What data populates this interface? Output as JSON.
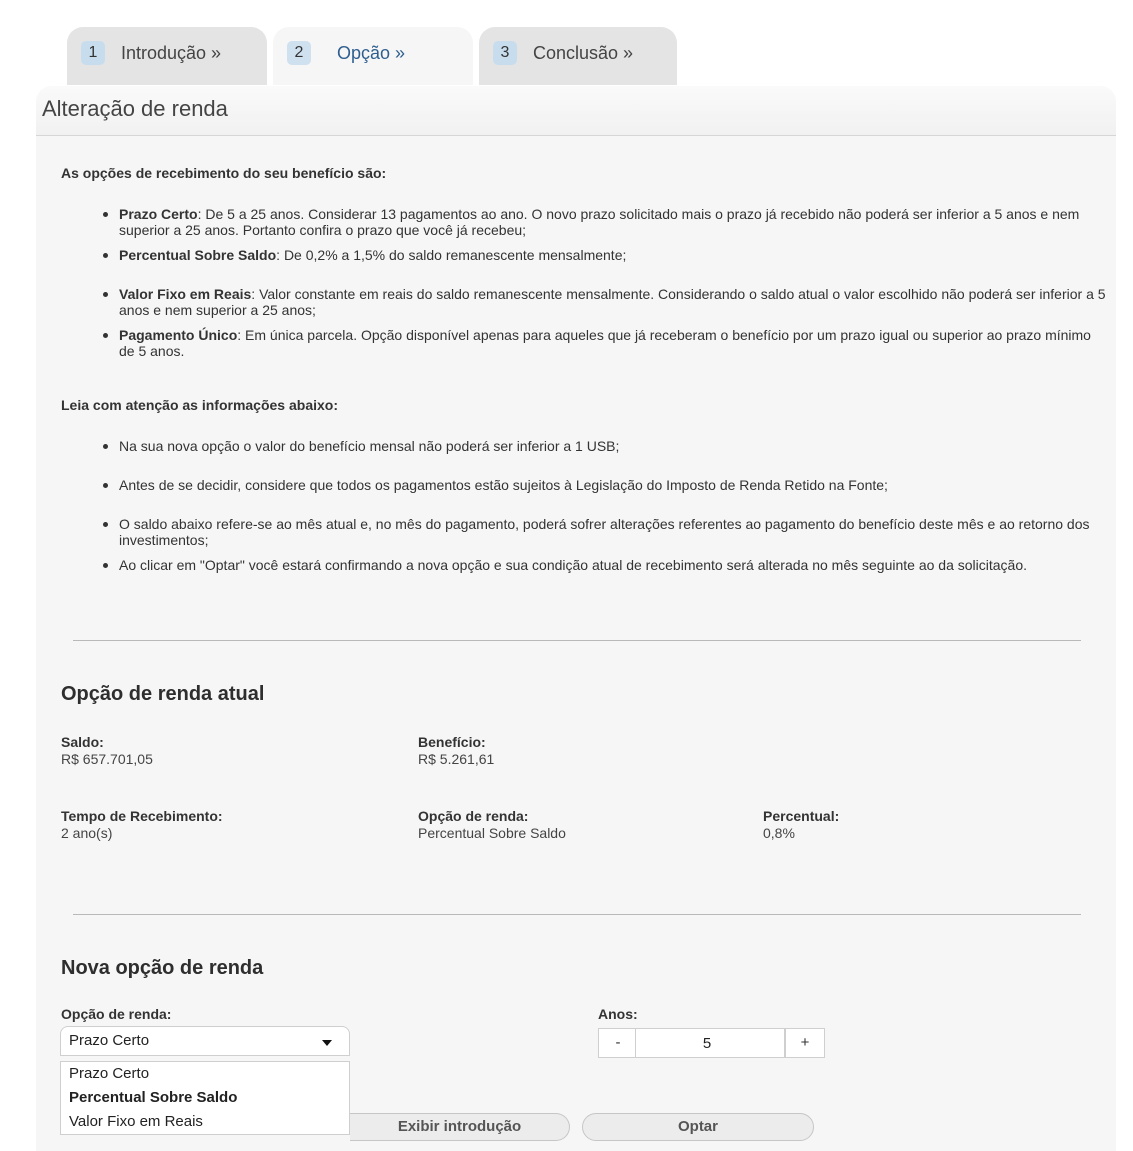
{
  "tabs": [
    {
      "num": "1",
      "label": "Introdução »"
    },
    {
      "num": "2",
      "label": "Opção »"
    },
    {
      "num": "3",
      "label": "Conclusão »"
    }
  ],
  "title": "Alteração de renda",
  "intro": "As opções de recebimento do seu benefício são:",
  "options_list": [
    {
      "bold": "Prazo Certo",
      "text": ": De 5 a 25 anos. Considerar 13 pagamentos ao ano. O novo prazo solicitado mais o prazo já recebido não poderá ser inferior a 5 anos e nem superior a 25 anos. Portanto confira o prazo que você já recebeu;"
    },
    {
      "bold": "Percentual Sobre Saldo",
      "text": ": De 0,2% a 1,5% do saldo remanescente mensalmente;"
    },
    {
      "bold": "Valor Fixo em Reais",
      "text": ": Valor constante em reais do saldo remanescente mensalmente. Considerando o saldo atual o valor escolhido não poderá ser inferior a 5 anos e nem superior a 25 anos;"
    },
    {
      "bold": "Pagamento Único",
      "text": ": Em única parcela. Opção disponível apenas para aqueles que já receberam o benefício por um prazo igual ou superior ao prazo mínimo de 5 anos."
    }
  ],
  "attention_title": "Leia com atenção as informações abaixo:",
  "attention_list": [
    "Na sua nova opção o valor do benefício mensal não poderá ser inferior a 1 USB;",
    "Antes de se decidir, considere que todos os pagamentos estão sujeitos à Legislação do Imposto de Renda Retido na Fonte;",
    "O saldo abaixo refere-se ao mês atual e, no mês do pagamento, poderá sofrer alterações referentes ao pagamento do benefício deste mês e ao retorno dos investimentos;",
    "Ao clicar em \"Optar\" você estará confirmando a nova opção e sua condição atual de recebimento será alterada no mês seguinte ao da solicitação."
  ],
  "current": {
    "title": "Opção de renda atual",
    "saldo_label": "Saldo:",
    "saldo_value": "R$ 657.701,05",
    "beneficio_label": "Benefício:",
    "beneficio_value": "R$ 5.261,61",
    "tempo_label": "Tempo de Recebimento:",
    "tempo_value": "2 ano(s)",
    "opcao_label": "Opção de renda:",
    "opcao_value": "Percentual Sobre Saldo",
    "percentual_label": "Percentual:",
    "percentual_value": "0,8%"
  },
  "new_option": {
    "title": "Nova opção de renda",
    "opcao_label": "Opção de renda:",
    "selected": "Prazo Certo",
    "dropdown_options": [
      "Prazo Certo",
      "Percentual Sobre Saldo",
      "Valor Fixo em Reais"
    ],
    "anos_label": "Anos:",
    "anos_value": "5",
    "minus": "-",
    "plus": "+"
  },
  "buttons": {
    "intro": "Exibir introdução",
    "optar": "Optar"
  }
}
